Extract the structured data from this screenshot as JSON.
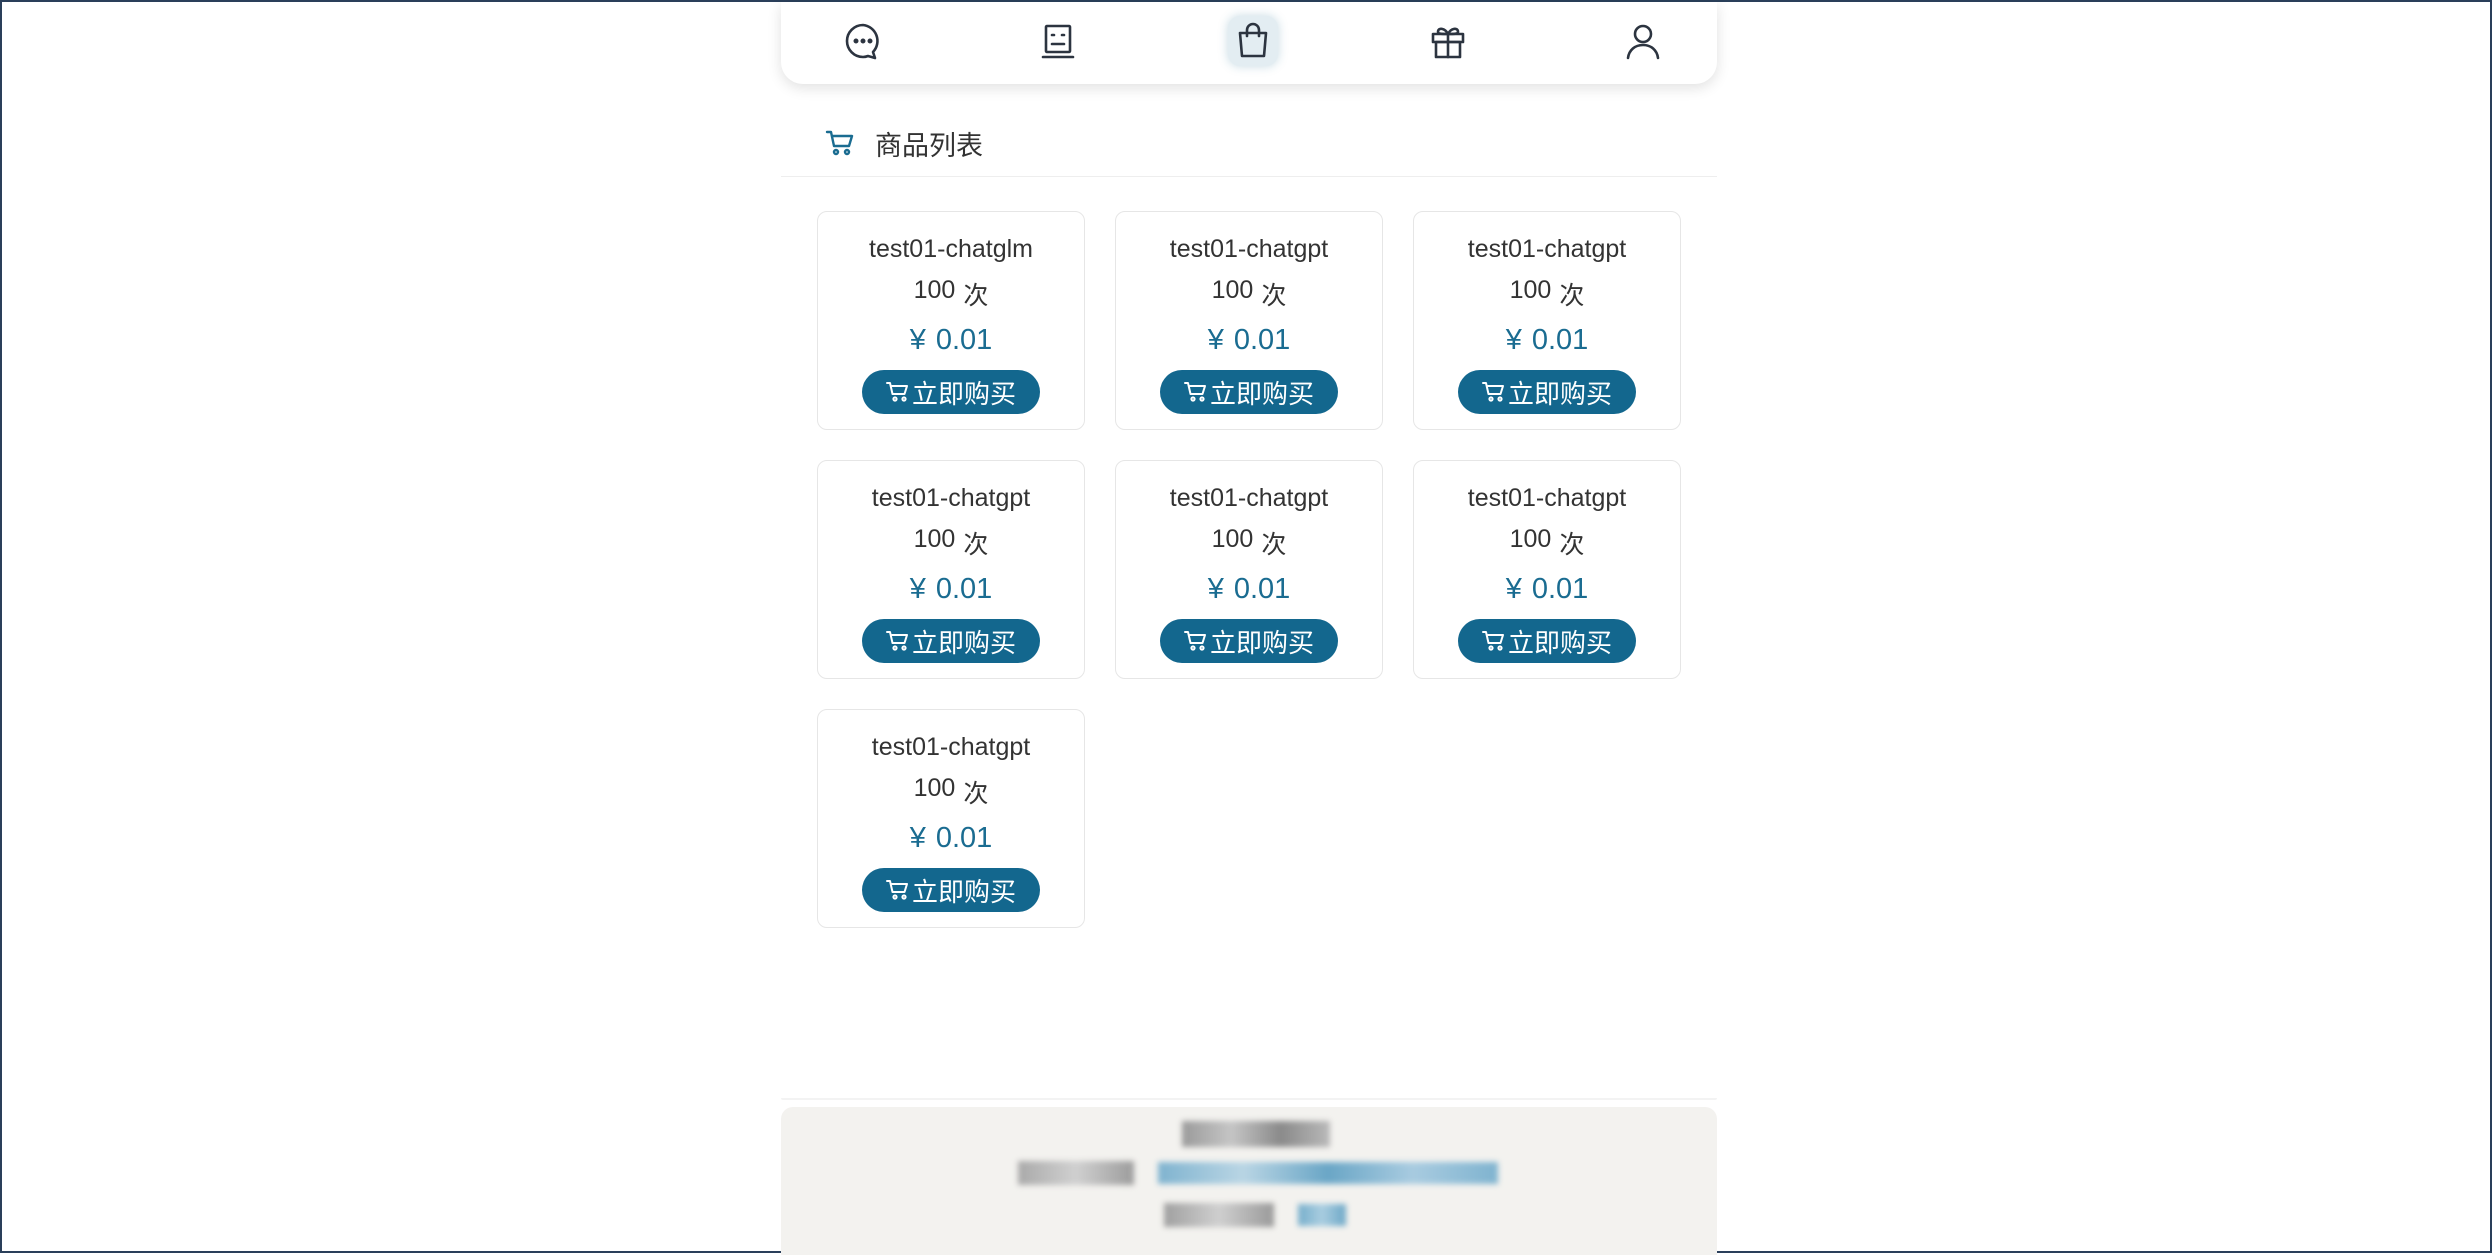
{
  "nav": {
    "items": [
      {
        "name": "chat",
        "icon": "chat-bubble-icon"
      },
      {
        "name": "robot",
        "icon": "robot-face-icon"
      },
      {
        "name": "shop",
        "icon": "shopping-bag-icon",
        "active": true
      },
      {
        "name": "gift",
        "icon": "gift-icon"
      },
      {
        "name": "user",
        "icon": "user-icon"
      }
    ]
  },
  "section": {
    "icon": "shopping-cart-icon",
    "title": "商品列表"
  },
  "products": [
    {
      "name": "test01-chatglm",
      "count": "100",
      "count_unit": "次",
      "currency": "¥",
      "price": "0.01",
      "buy_label": "立即购买"
    },
    {
      "name": "test01-chatgpt",
      "count": "100",
      "count_unit": "次",
      "currency": "¥",
      "price": "0.01",
      "buy_label": "立即购买"
    },
    {
      "name": "test01-chatgpt",
      "count": "100",
      "count_unit": "次",
      "currency": "¥",
      "price": "0.01",
      "buy_label": "立即购买"
    },
    {
      "name": "test01-chatgpt",
      "count": "100",
      "count_unit": "次",
      "currency": "¥",
      "price": "0.01",
      "buy_label": "立即购买"
    },
    {
      "name": "test01-chatgpt",
      "count": "100",
      "count_unit": "次",
      "currency": "¥",
      "price": "0.01",
      "buy_label": "立即购买"
    },
    {
      "name": "test01-chatgpt",
      "count": "100",
      "count_unit": "次",
      "currency": "¥",
      "price": "0.01",
      "buy_label": "立即购买"
    },
    {
      "name": "test01-chatgpt",
      "count": "100",
      "count_unit": "次",
      "currency": "¥",
      "price": "0.01",
      "buy_label": "立即购买"
    }
  ],
  "footer": {
    "line1": "",
    "line2_label": "",
    "line2_link": "",
    "line3_label": "",
    "line3_link": ""
  },
  "colors": {
    "accent": "#13678e",
    "price": "#1a6c91",
    "footer_bg": "#f3f2ef",
    "frame_border": "#2a3f5a"
  }
}
